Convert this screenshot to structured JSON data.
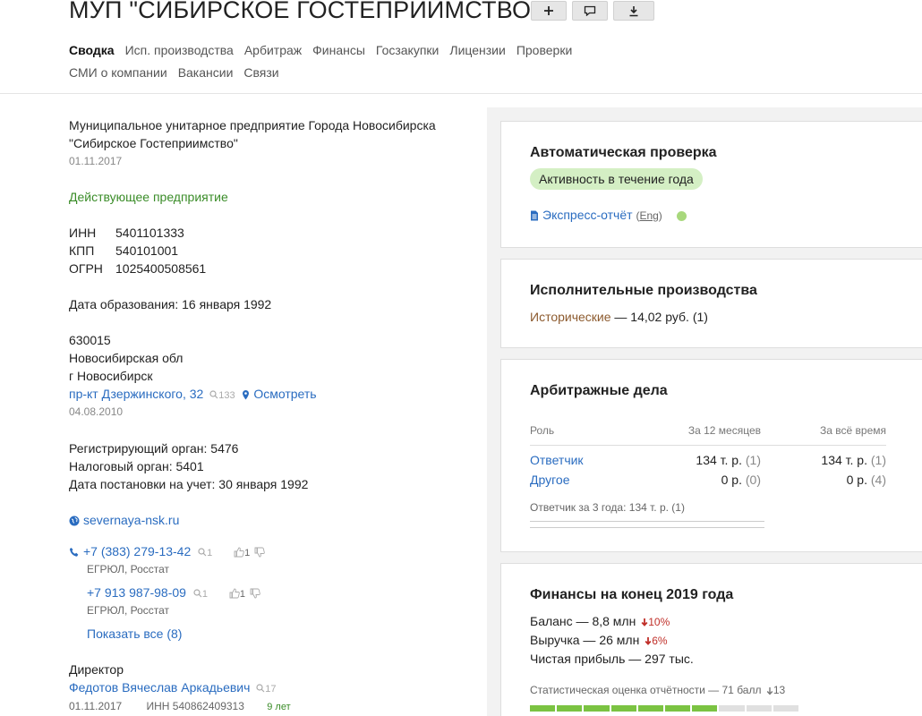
{
  "header": {
    "title": "МУП \"СИБИРСКОЕ ГОСТЕПРИИМСТВО\"",
    "nav_row1": [
      "Сводка",
      "Исп. производства",
      "Арбитраж",
      "Финансы",
      "Госзакупки",
      "Лицензии",
      "Проверки"
    ],
    "nav_row2": [
      "СМИ о компании",
      "Вакансии",
      "Связи"
    ],
    "active_tab": "Сводка"
  },
  "summary": {
    "full_name_line1": "Муниципальное унитарное предприятие Города Новосибирска",
    "full_name_line2": "\"Сибирское Гостеприимство\"",
    "name_date": "01.11.2017",
    "status": "Действующее предприятие",
    "inn_label": "ИНН",
    "inn": "5401101333",
    "kpp_label": "КПП",
    "kpp": "540101001",
    "ogrn_label": "ОГРН",
    "ogrn": "1025400508561",
    "founded": "Дата образования: 16 января 1992",
    "postcode": "630015",
    "region": "Новосибирская обл",
    "city": "г Новосибирск",
    "street": "пр-кт Дзержинского, 32",
    "street_count": "133",
    "view_link": "Осмотреть",
    "address_date": "04.08.2010",
    "reg_authority": "Регистрирующий орган: 5476",
    "tax_authority": "Налоговый орган: 5401",
    "tax_date": "Дата постановки на учет: 30 января 1992",
    "website": "severnaya-nsk.ru",
    "phone1": "+7 (383) 279-13-42",
    "phone1_search": "1",
    "phone1_likes": "1",
    "phone1_source": "ЕГРЮЛ, Росстат",
    "phone2": "+7 913 987-98-09",
    "phone2_search": "1",
    "phone2_likes": "1",
    "phone2_source": "ЕГРЮЛ, Росстат",
    "show_all": "Показать все (8)",
    "director_label": "Директор",
    "director_name": "Федотов Вячеслав Аркадьевич",
    "director_count": "17",
    "director_date": "01.11.2017",
    "director_inn": "ИНН 540862409313",
    "director_tenure": "9 лет"
  },
  "auto_check": {
    "title": "Автоматическая проверка",
    "pill": "Активность в течение года",
    "report_link": "Экспресс-отчёт",
    "eng_label": "Eng"
  },
  "exec": {
    "title": "Исполнительные производства",
    "historic_label": "Исторические",
    "historic_value": " — 14,02 руб. (1)"
  },
  "arbitration": {
    "title": "Арбитражные дела",
    "col_role": "Роль",
    "col_12m": "За 12 месяцев",
    "col_all": "За всё время",
    "rows": [
      {
        "role": "Ответчик",
        "m12": "134 т. р.",
        "m12_cnt": "(1)",
        "all": "134 т. р.",
        "all_cnt": "(1)"
      },
      {
        "role": "Другое",
        "m12": "0 р.",
        "m12_cnt": "(0)",
        "all": "0 р.",
        "all_cnt": "(4)"
      }
    ],
    "note": "Ответчик за 3 года: 134 т. р. (1)"
  },
  "finance": {
    "title": "Финансы на конец 2019 года",
    "balance": "Баланс — 8,8 млн",
    "balance_change": "10%",
    "revenue": "Выручка — 26 млн",
    "revenue_change": "6%",
    "profit": "Чистая прибыль — 297 тыс.",
    "score": "Статистическая оценка отчётности — 71 балл",
    "score_change": "13",
    "score_fraction": 0.71,
    "colors": {
      "positive": "#7bc342",
      "negative": "#c0302a"
    }
  }
}
